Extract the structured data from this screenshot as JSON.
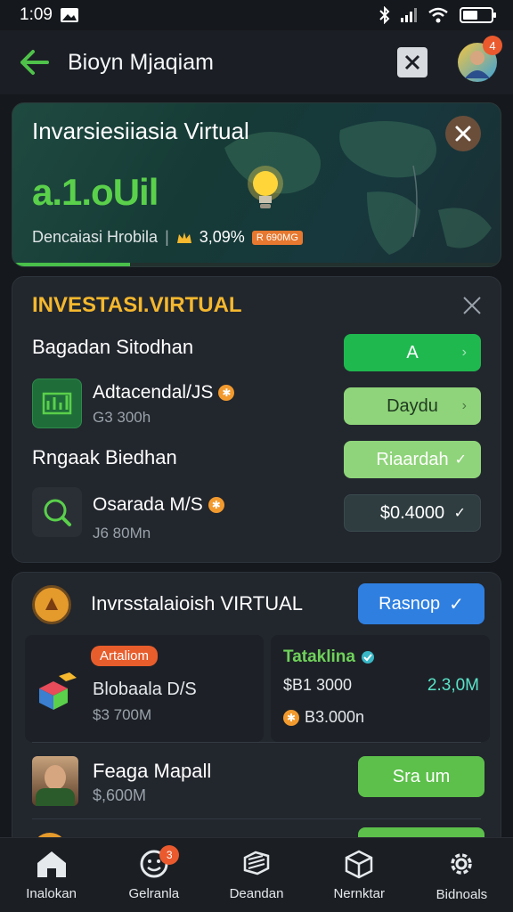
{
  "status": {
    "time": "1:09"
  },
  "header": {
    "title": "Bioyn Mjaqiam",
    "notif_count": "4"
  },
  "hero": {
    "title": "Invarsiesiiasia Virtual",
    "big_value": "a.1.oUil",
    "subtitle": "Dencaiasi Hrobila",
    "percent": "3,09%",
    "chip": "R 690MG",
    "progress": 0.24
  },
  "section1": {
    "title": "INVESTASI.VIRTUAL",
    "group1_head": "Bagadan Sitodhan",
    "btn_a": "A",
    "item1": {
      "name": "Adtacendal/JS",
      "value": "G3 300h",
      "button": "Daydu"
    },
    "group2_head": "Rngaak Biedhan",
    "btn_c": "Riaardah",
    "item2": {
      "name": "Osarada M/S",
      "value": "J6 80Mn",
      "button": "$0.4000"
    }
  },
  "section2": {
    "title": "Invrsstalaioish VIRTUAL",
    "button": "Rasnop",
    "left": {
      "tag": "Artaliom",
      "name": "Blobaala D/S",
      "value": "$3 700M"
    },
    "right": {
      "tag": "Tataklina",
      "value1": "$B1 3000",
      "value2": "2.3,0M",
      "value3": "B3.000n"
    },
    "person": {
      "name": "Feaga Mapall",
      "value": "$,600M",
      "button": "Sra um"
    }
  },
  "nav": {
    "items": [
      {
        "label": "Inalokan"
      },
      {
        "label": "Gelranla",
        "badge": "3"
      },
      {
        "label": "Deandan"
      },
      {
        "label": "Nernktar"
      },
      {
        "label": "Bidnoals"
      }
    ]
  },
  "colors": {
    "accent_green": "#5ad04b",
    "accent_orange": "#f5b82e",
    "accent_blue": "#2f7fe0",
    "badge": "#ea5a2e"
  }
}
